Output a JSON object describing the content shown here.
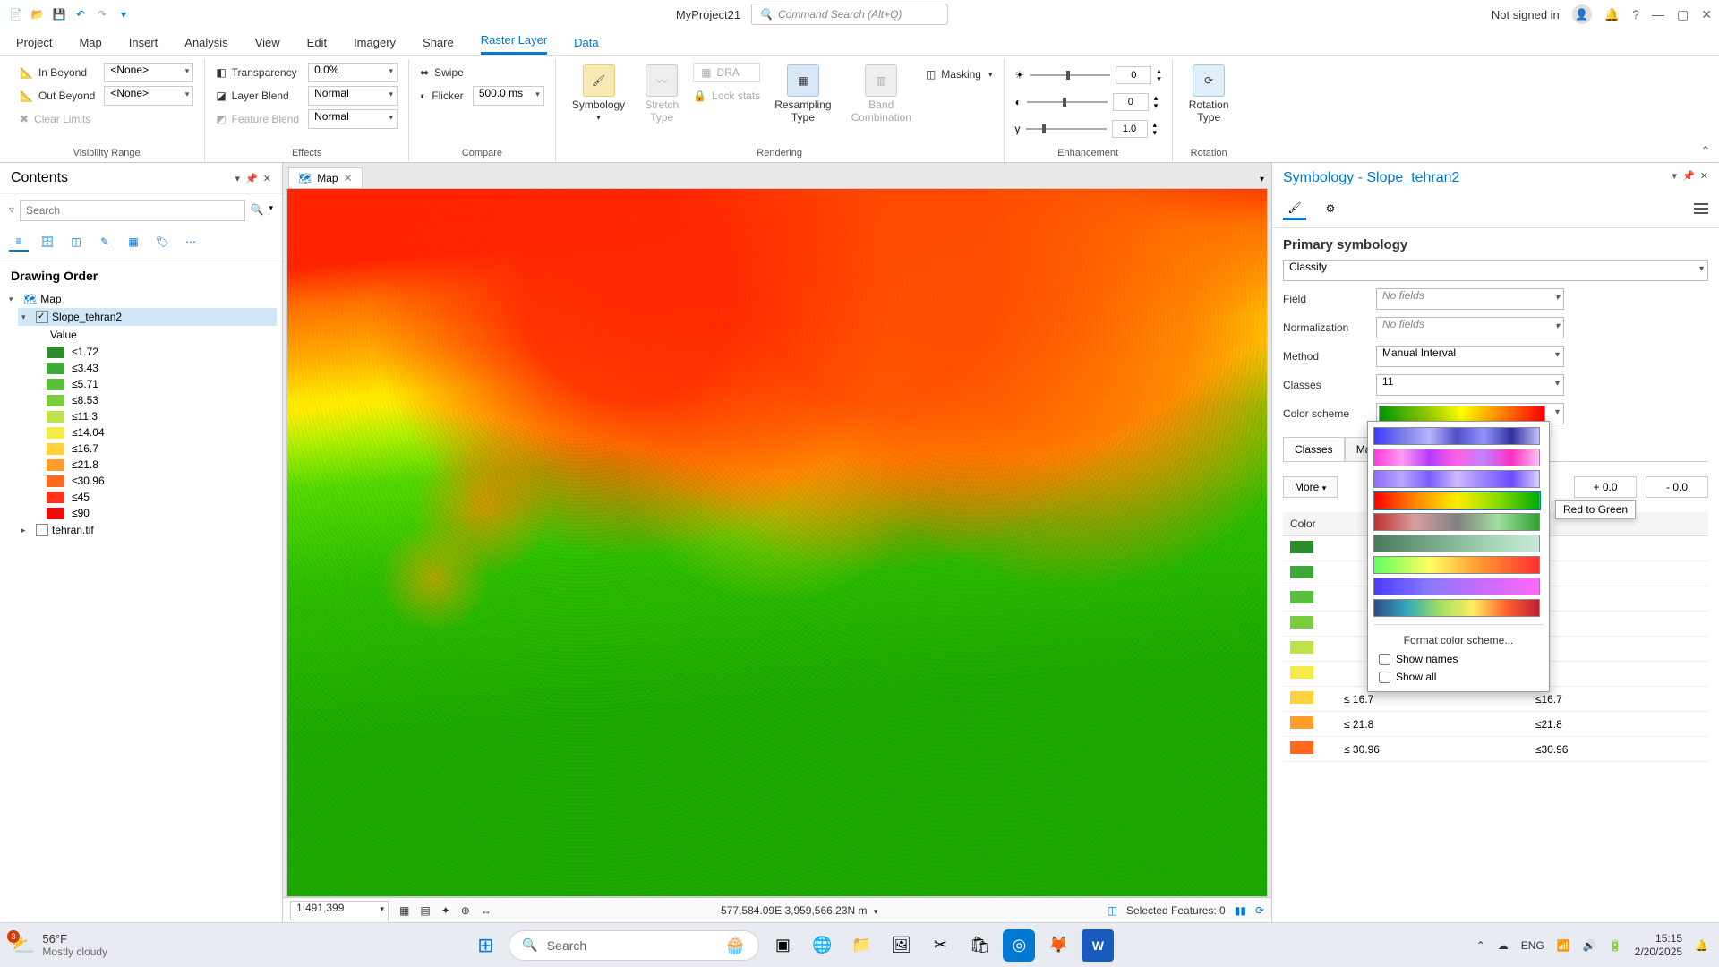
{
  "titlebar": {
    "app_title": "MyProject21",
    "cmd_placeholder": "Command Search (Alt+Q)",
    "signin": "Not signed in"
  },
  "ribbon": {
    "tabs": [
      "Project",
      "Map",
      "Insert",
      "Analysis",
      "View",
      "Edit",
      "Imagery",
      "Share",
      "Raster Layer",
      "Data"
    ],
    "active_tab": "Raster Layer",
    "groups": {
      "visibility": {
        "label": "Visibility Range",
        "in_beyond": "In Beyond",
        "out_beyond": "Out Beyond",
        "clear_limits": "Clear Limits",
        "none": "<None>"
      },
      "effects": {
        "label": "Effects",
        "transparency": "Transparency",
        "transparency_val": "0.0%",
        "layer_blend": "Layer Blend",
        "layer_blend_val": "Normal",
        "feature_blend": "Feature Blend",
        "feature_blend_val": "Normal"
      },
      "compare": {
        "label": "Compare",
        "swipe": "Swipe",
        "flicker": "Flicker",
        "flicker_val": "500.0  ms"
      },
      "rendering": {
        "label": "Rendering",
        "symbology": "Symbology",
        "stretch": "Stretch\nType",
        "dra": "DRA",
        "lock_stats": "Lock stats",
        "resampling": "Resampling\nType",
        "band": "Band\nCombination",
        "masking": "Masking"
      },
      "enhancement": {
        "label": "Enhancement",
        "v1": "0",
        "v2": "0",
        "v3": "1.0"
      },
      "rotation": {
        "label": "Rotation",
        "btn": "Rotation\nType"
      }
    }
  },
  "contents": {
    "title": "Contents",
    "search_placeholder": "Search",
    "section": "Drawing Order",
    "map_node": "Map",
    "layer": "Slope_tehran2",
    "value_label": "Value",
    "legend": [
      {
        "c": "#2e8b2e",
        "l": "≤1.72"
      },
      {
        "c": "#3fa83b",
        "l": "≤3.43"
      },
      {
        "c": "#5bbf3e",
        "l": "≤5.71"
      },
      {
        "c": "#7bcc3f",
        "l": "≤8.53"
      },
      {
        "c": "#bde24a",
        "l": "≤11.3"
      },
      {
        "c": "#f5ec4a",
        "l": "≤14.04"
      },
      {
        "c": "#ffd23b",
        "l": "≤16.7"
      },
      {
        "c": "#ff9e2c",
        "l": "≤21.8"
      },
      {
        "c": "#ff6a1f",
        "l": "≤30.96"
      },
      {
        "c": "#ff321a",
        "l": "≤45"
      },
      {
        "c": "#f50a0a",
        "l": "≤90"
      }
    ],
    "other_layer": "tehran.tif"
  },
  "map": {
    "tab": "Map",
    "scale": "1:491,399",
    "coords": "577,584.09E 3,959,566.23N m",
    "selected": "Selected Features: 0"
  },
  "symbology": {
    "title": "Symbology - Slope_tehran2",
    "primary": "Primary symbology",
    "type": "Classify",
    "field_label": "Field",
    "field_val": "No fields",
    "norm_label": "Normalization",
    "norm_val": "No fields",
    "method_label": "Method",
    "method_val": "Manual Interval",
    "classes_label": "Classes",
    "classes_val": "11",
    "scheme_label": "Color scheme",
    "sub_tabs": [
      "Classes",
      "Mas"
    ],
    "more": "More",
    "plus": "+ 0.0",
    "minus": "- 0.0",
    "col_color": "Color",
    "rows": [
      {
        "c": "#2e8b2e",
        "u": "",
        "l": ""
      },
      {
        "c": "#3fa83b",
        "u": "",
        "l": ""
      },
      {
        "c": "#5bbf3e",
        "u": "",
        "l": ""
      },
      {
        "c": "#7bcc3f",
        "u": "",
        "l": ""
      },
      {
        "c": "#bde24a",
        "u": "",
        "l": ""
      },
      {
        "c": "#f5ec4a",
        "u": "",
        "l": ""
      },
      {
        "c": "#ffd23b",
        "u": "≤  16.7",
        "l": "≤16.7"
      },
      {
        "c": "#ff9e2c",
        "u": "≤  21.8",
        "l": "≤21.8"
      },
      {
        "c": "#ff6a1f",
        "u": "≤  30.96",
        "l": "≤30.96"
      }
    ],
    "popup": {
      "format": "Format color scheme...",
      "show_names": "Show names",
      "show_all": "Show all",
      "tooltip": "Red to Green"
    }
  },
  "taskbar": {
    "temp": "56°F",
    "cond": "Mostly cloudy",
    "search": "Search",
    "lang": "ENG",
    "time": "15:15",
    "date": "2/20/2025",
    "badge": "3"
  }
}
